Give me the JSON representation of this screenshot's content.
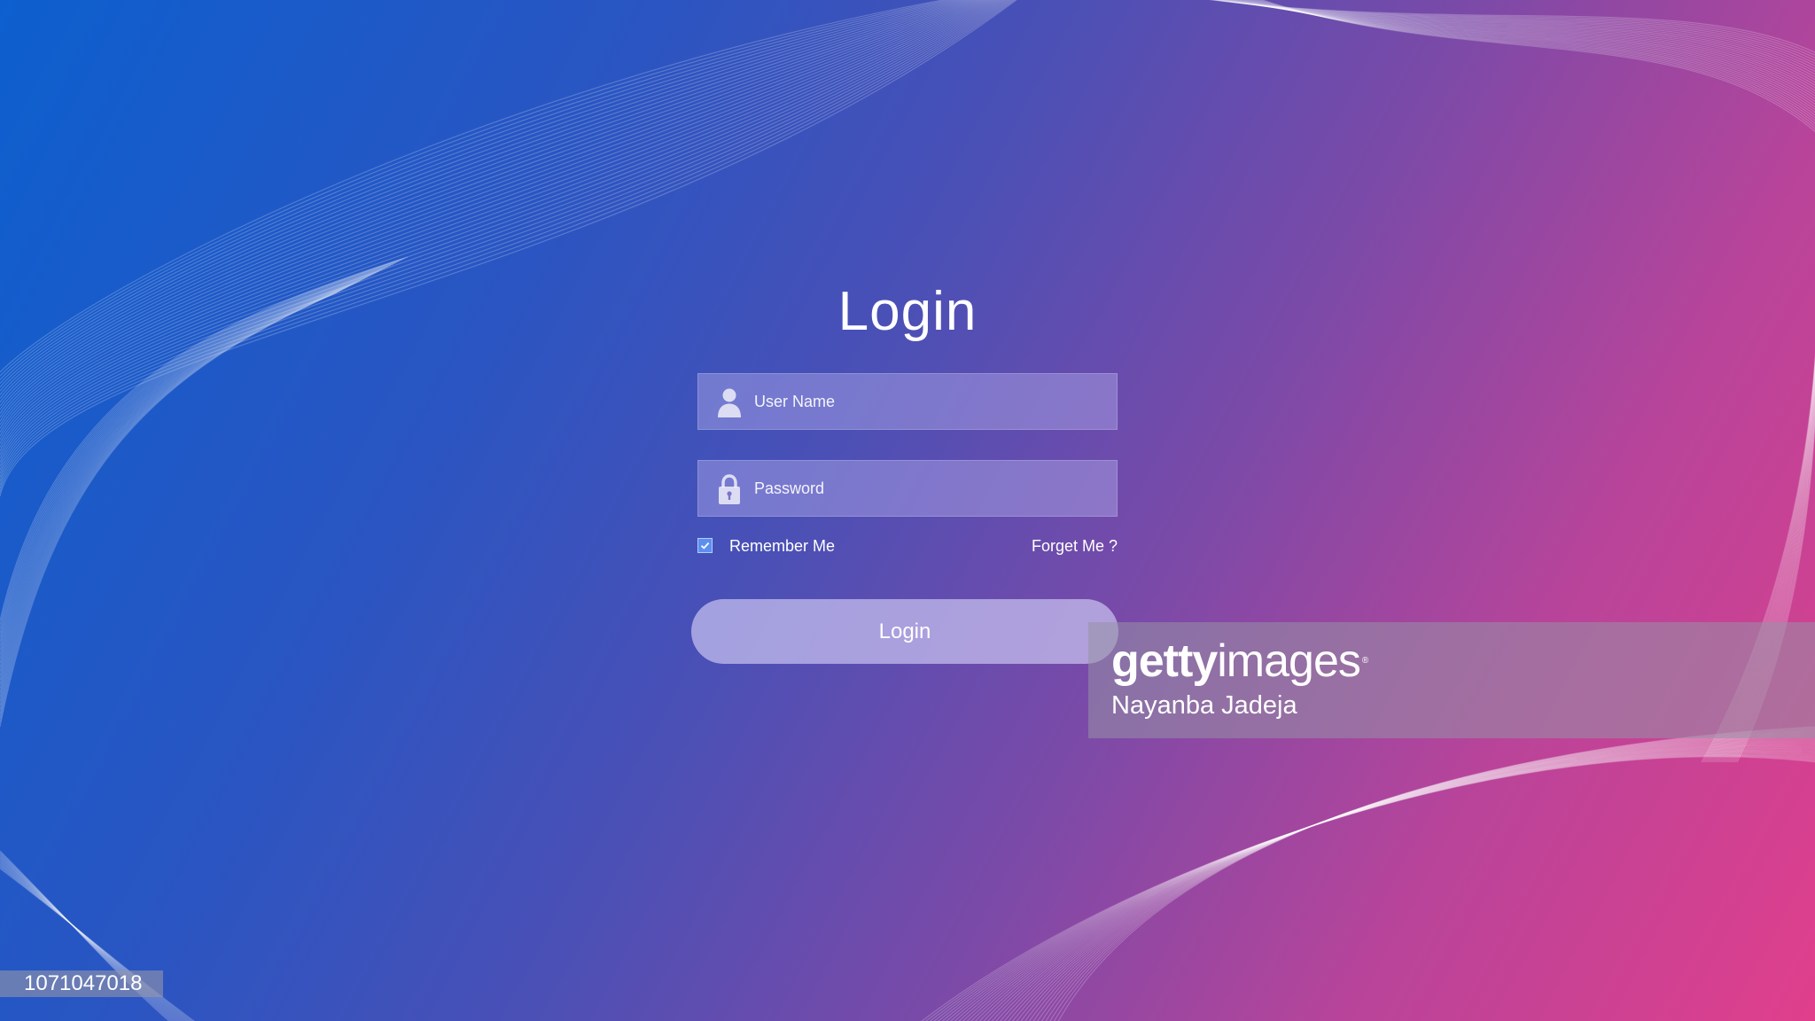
{
  "page": {
    "title": "Login"
  },
  "form": {
    "username": {
      "placeholder": "User Name",
      "value": "",
      "icon": "user-icon"
    },
    "password": {
      "placeholder": "Password",
      "value": "",
      "icon": "lock-icon"
    },
    "remember_me": {
      "label": "Remember Me",
      "checked": true
    },
    "forget_link": "Forget Me ?",
    "submit_label": "Login"
  },
  "watermark": {
    "logo_bold": "getty",
    "logo_regular": "images",
    "logo_mark": "®",
    "credit": "Nayanba Jadeja",
    "image_id": "1071047018"
  },
  "colors": {
    "gradient_start": "#0d5fcf",
    "gradient_mid": "#4a50b6",
    "gradient_end": "#e03f8c",
    "checkbox_fill": "#5d8ff0"
  }
}
